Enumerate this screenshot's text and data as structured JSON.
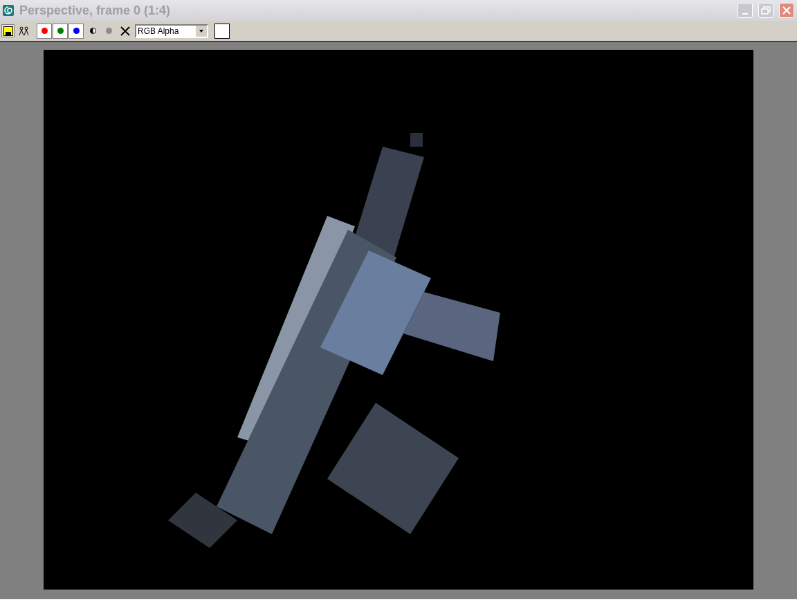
{
  "window": {
    "title": "Perspective, frame 0 (1:4)",
    "active": false
  },
  "toolbar": {
    "channels": [
      {
        "color": "#ff0000",
        "selected": true
      },
      {
        "color": "#008000",
        "selected": true
      },
      {
        "color": "#0000ff",
        "selected": true
      }
    ],
    "channel_dropdown": {
      "value": "RGB Alpha"
    },
    "swatch": {
      "color": "#ffffff"
    }
  }
}
